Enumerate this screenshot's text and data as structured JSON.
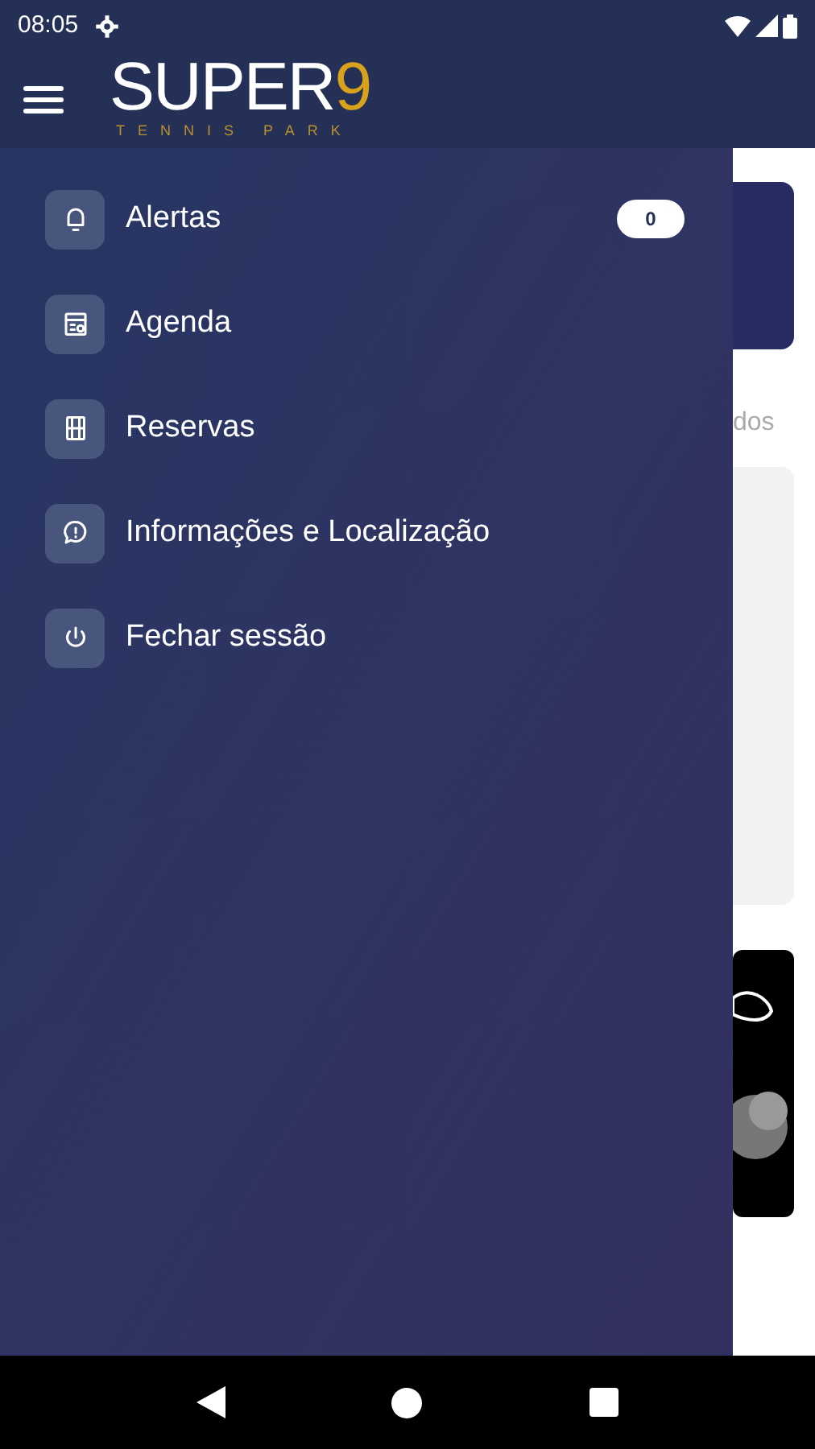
{
  "status_bar": {
    "time": "08:05"
  },
  "header": {
    "logo_main": "SUPER",
    "logo_accent": "9",
    "logo_sub": "TENNIS PARK"
  },
  "drawer": {
    "items": [
      {
        "label": "Alertas",
        "badge": "0"
      },
      {
        "label": "Agenda"
      },
      {
        "label": "Reservas"
      },
      {
        "label": "Informações e Localização"
      },
      {
        "label": "Fechar sessão"
      }
    ]
  },
  "background": {
    "partial_text": "dos"
  }
}
